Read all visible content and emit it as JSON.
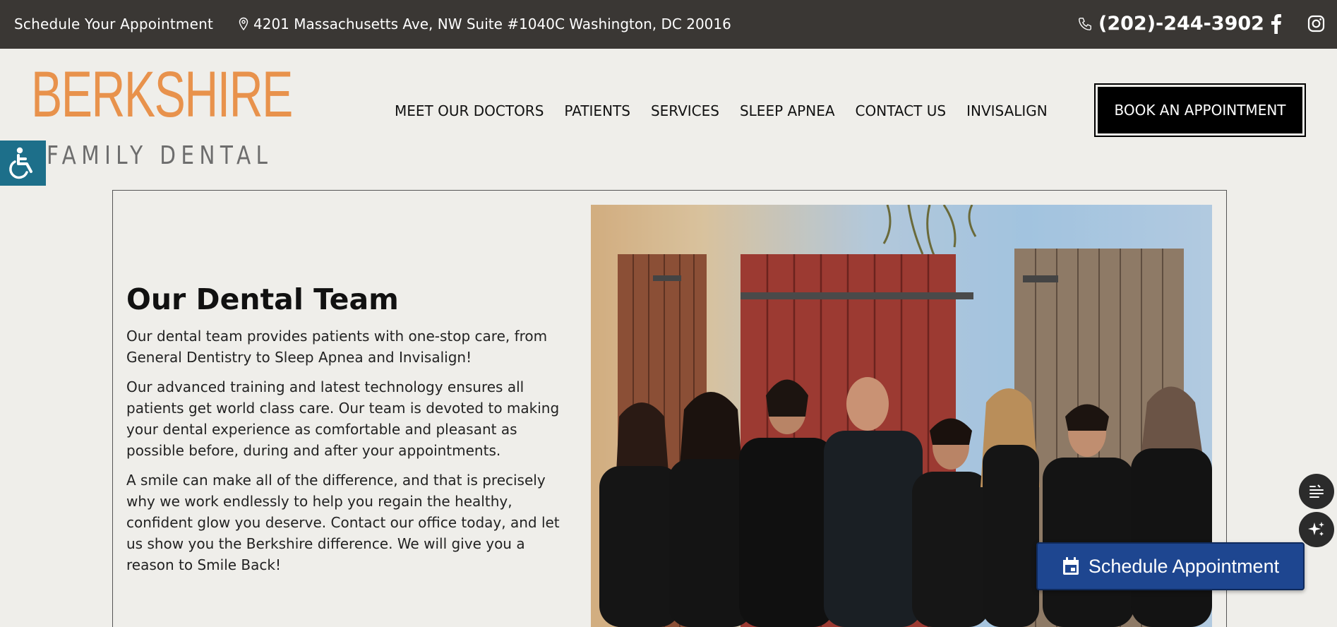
{
  "topbar": {
    "schedule_label": "Schedule Your Appointment",
    "address": "4201 Massachusetts Ave, NW Suite #1040C Washington, DC 20016",
    "phone": "(202)-244-3902",
    "icons": [
      "map-pin-icon",
      "phone-icon",
      "facebook-icon",
      "instagram-icon"
    ]
  },
  "logo": {
    "line1": "BERKSHIRE",
    "line2": "FAMILY DENTAL",
    "colors": {
      "line1": "#e8924c",
      "line2": "#6d6d6d"
    }
  },
  "nav": {
    "items": [
      {
        "label": "MEET OUR DOCTORS"
      },
      {
        "label": "PATIENTS"
      },
      {
        "label": "SERVICES"
      },
      {
        "label": "SLEEP APNEA"
      },
      {
        "label": "CONTACT US"
      },
      {
        "label": "INVISALIGN"
      }
    ],
    "cta_label": "BOOK AN APPOINTMENT"
  },
  "main": {
    "title": "Our Dental Team",
    "paragraphs": [
      "Our dental team provides patients with one-stop care, from General Dentistry to Sleep Apnea and Invisalign!",
      "Our advanced training and latest technology ensures all patients get world class care. Our team is devoted to making your dental experience as comfortable and pleasant as possible before, during and after your appointments.",
      "A smile can make all of the difference, and that is precisely why we work endlessly to help you regain the healthy, confident glow you deserve. Contact our office today, and let us show you the Berkshire difference. We will give you a reason to Smile Back!"
    ]
  },
  "widgets": {
    "schedule_button": "Schedule Appointment",
    "icons": [
      "accessibility-icon",
      "notes-icon",
      "sparkle-icon",
      "calendar-icon"
    ]
  },
  "colors": {
    "topbar_bg": "#3a3734",
    "page_bg": "#efeeea",
    "schedule_btn": "#1e4690",
    "accessibility_btn": "#1d6f8a"
  }
}
